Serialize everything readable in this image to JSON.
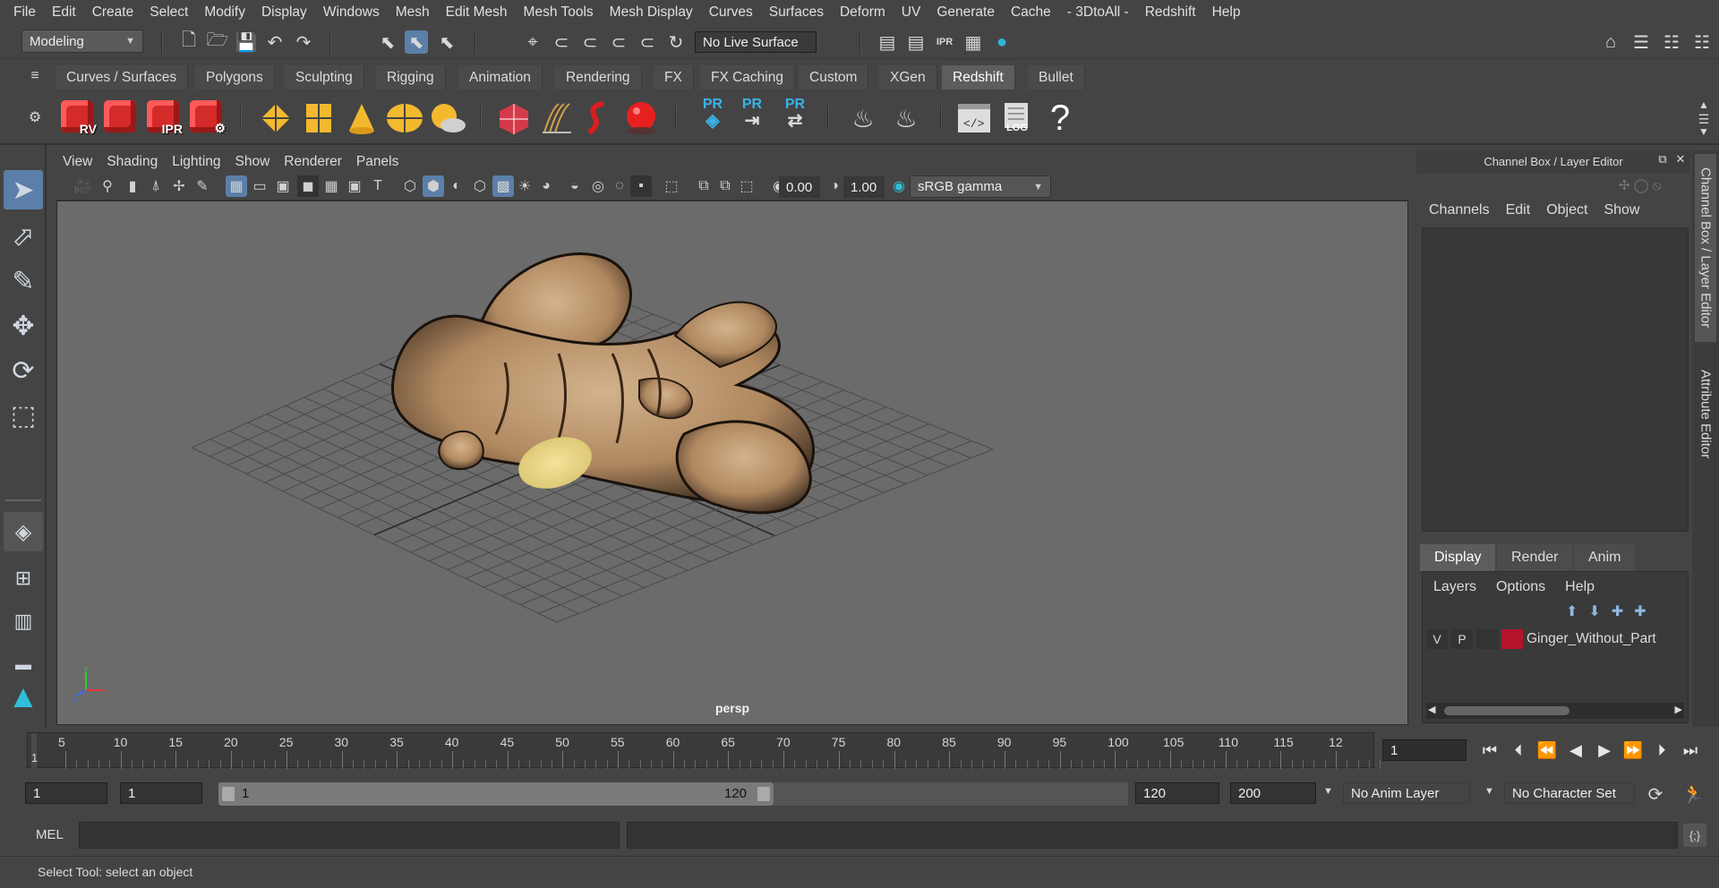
{
  "menubar": [
    "File",
    "Edit",
    "Create",
    "Select",
    "Modify",
    "Display",
    "Windows",
    "Mesh",
    "Edit Mesh",
    "Mesh Tools",
    "Mesh Display",
    "Curves",
    "Surfaces",
    "Deform",
    "UV",
    "Generate",
    "Cache",
    "- 3DtoAll -",
    "Redshift",
    "Help"
  ],
  "statusline": {
    "workspace": "Modeling",
    "live_surface": "No Live Surface"
  },
  "shelf_tabs": [
    "Curves / Surfaces",
    "Polygons",
    "Sculpting",
    "Rigging",
    "Animation",
    "Rendering",
    "FX",
    "FX Caching",
    "Custom",
    "XGen",
    "Redshift",
    "Bullet"
  ],
  "shelf_active": "Redshift",
  "shelf_icons": {
    "rv": "RV",
    "ipr": "IPR",
    "log": "LOG",
    "pr": "PR",
    "help": "?"
  },
  "viewport": {
    "menu": [
      "View",
      "Shading",
      "Lighting",
      "Show",
      "Renderer",
      "Panels"
    ],
    "exposure": "0.00",
    "gamma": "1.00",
    "colorspace": "sRGB gamma",
    "camera": "persp",
    "axis": {
      "x": "x",
      "y": "y",
      "z": "z"
    }
  },
  "channelbox": {
    "title": "Channel Box / Layer Editor",
    "menu": [
      "Channels",
      "Edit",
      "Object",
      "Show"
    ]
  },
  "layer_editor": {
    "tabs": [
      "Display",
      "Render",
      "Anim"
    ],
    "active_tab": "Display",
    "menu": [
      "Layers",
      "Options",
      "Help"
    ],
    "layer": {
      "v": "V",
      "p": "P",
      "name": "Ginger_Without_Part",
      "color": "#b5122c"
    }
  },
  "sidetabs": [
    "Channel Box / Layer Editor",
    "Attribute Editor"
  ],
  "timeline": {
    "ticks": [
      "5",
      "10",
      "15",
      "20",
      "25",
      "30",
      "35",
      "40",
      "45",
      "50",
      "55",
      "60",
      "65",
      "70",
      "75",
      "80",
      "85",
      "90",
      "95",
      "100",
      "105",
      "110",
      "115",
      "12"
    ],
    "current_frame_marker": "1",
    "current_frame": "1"
  },
  "range": {
    "start": "1",
    "playback_start": "1",
    "slider_start": "1",
    "slider_end": "120",
    "playback_end": "120",
    "end": "200",
    "anim_layer": "No Anim Layer",
    "character_set": "No Character Set"
  },
  "cmdline": {
    "label": "MEL"
  },
  "helpline": "Select Tool: select an object"
}
